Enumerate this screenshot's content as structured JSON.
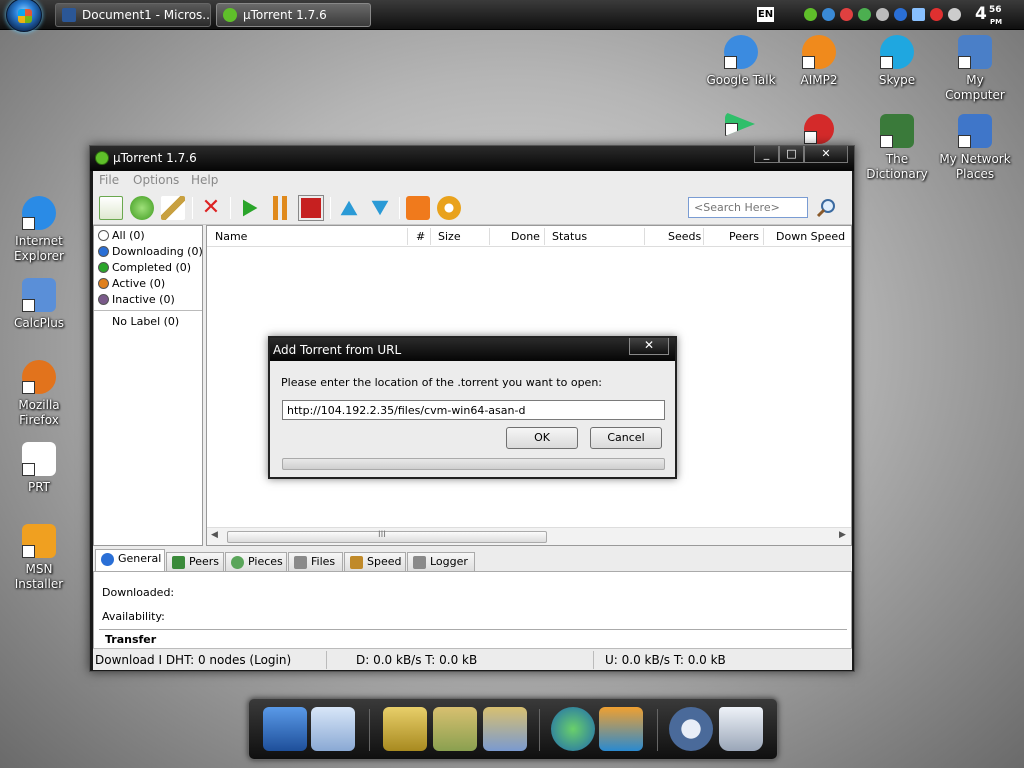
{
  "taskbar": {
    "buttons": [
      {
        "label": "Document1 - Micros..."
      },
      {
        "label": "µTorrent 1.7.6"
      }
    ],
    "language": "EN",
    "clock": {
      "hour": "4",
      "minutes": "56",
      "ampm": "PM"
    }
  },
  "desktop_icons": [
    {
      "label": "Google Talk",
      "color": "#3b8be0"
    },
    {
      "label": "AIMP2",
      "color": "#f08a1c"
    },
    {
      "label": "Skype",
      "color": "#1fa7e0"
    },
    {
      "label": "My Computer",
      "color": "#4a7fc8"
    },
    {
      "label": "The Dictionary",
      "color": "#3a7a3a"
    },
    {
      "label": "My Network Places",
      "color": "#3f76c9"
    },
    {
      "label": "Internet Explorer",
      "color": "#2a8be6"
    },
    {
      "label": "CalcPlus",
      "color": "#5a8fd8"
    },
    {
      "label": "Mozilla Firefox",
      "color": "#e2731c"
    },
    {
      "label": "PRT",
      "color": "#ffffff"
    },
    {
      "label": "MSN Installer",
      "color": "#f0a020"
    }
  ],
  "window": {
    "title": "µTorrent 1.7.6",
    "controls": {
      "minimize": "_",
      "maximize": "□",
      "close": "✕"
    },
    "menu": [
      "File",
      "Options",
      "Help"
    ],
    "search": {
      "placeholder": "<Search Here>"
    },
    "sidebar": {
      "items": [
        {
          "label": "All (0)",
          "icon": "all-icon",
          "color": "#555555"
        },
        {
          "label": "Downloading (0)",
          "icon": "downloading-icon",
          "color": "#2a6fd6"
        },
        {
          "label": "Completed (0)",
          "icon": "completed-icon",
          "color": "#2aa52a"
        },
        {
          "label": "Active (0)",
          "icon": "active-icon",
          "color": "#e0801c"
        },
        {
          "label": "Inactive (0)",
          "icon": "inactive-icon",
          "color": "#7a5a8a"
        }
      ],
      "no_label": "No Label (0)"
    },
    "columns": [
      "Name",
      "#",
      "Size",
      "Done",
      "Status",
      "Seeds",
      "Peers",
      "Down Speed"
    ],
    "scroll_grip": "III",
    "tabs": [
      {
        "label": "General",
        "icon": "info-icon",
        "color": "#2a6fd6"
      },
      {
        "label": "Peers",
        "icon": "peers-icon",
        "color": "#3a8a3a"
      },
      {
        "label": "Pieces",
        "icon": "pieces-icon",
        "color": "#5aa55a"
      },
      {
        "label": "Files",
        "icon": "files-icon",
        "color": "#8a8a8a"
      },
      {
        "label": "Speed",
        "icon": "speed-icon",
        "color": "#c08a2a"
      },
      {
        "label": "Logger",
        "icon": "logger-icon",
        "color": "#8a8a8a"
      }
    ],
    "general": {
      "downloaded_label": "Downloaded:",
      "availability_label": "Availability:",
      "transfer_label": "Transfer"
    },
    "status": {
      "left": "Download I DHT: 0 nodes (Login)",
      "download": "D: 0.0 kB/s T: 0.0 kB",
      "upload": "U: 0.0 kB/s T: 0.0 kB"
    }
  },
  "dialog": {
    "title": "Add Torrent from URL",
    "close": "✕",
    "prompt": "Please enter the location of the .torrent you want to open:",
    "url": "http://104.192.2.35/files/cvm-win64-asan-d",
    "ok": "OK",
    "cancel": "Cancel"
  }
}
